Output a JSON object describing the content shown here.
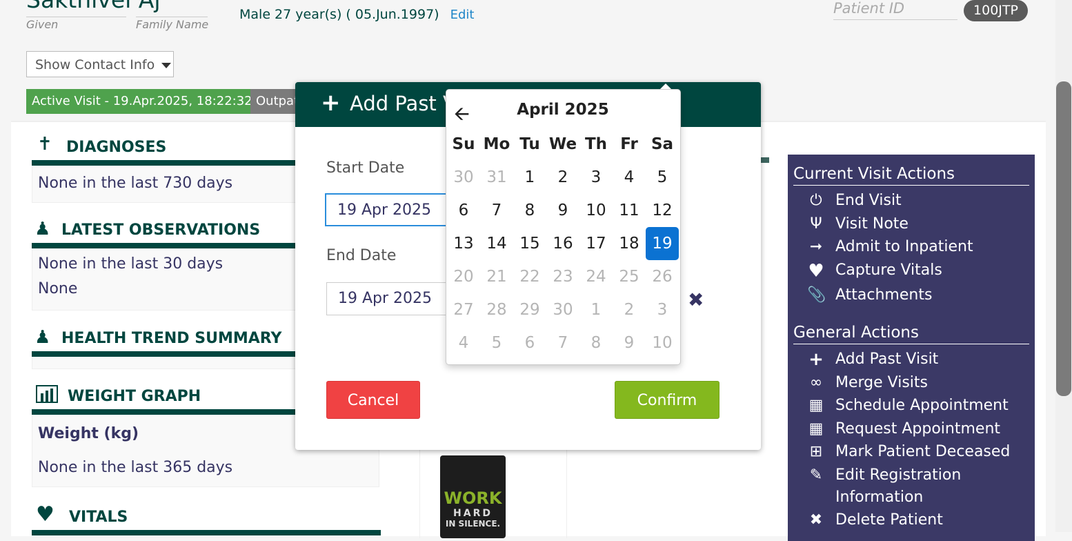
{
  "patient": {
    "name": "Sakthivel Aj",
    "given_caption": "Given",
    "family_caption": "Family Name",
    "demographics": "Male  27 year(s) ( 05.Jun.1997)",
    "edit_label": "Edit",
    "patient_id_placeholder": "Patient ID",
    "patient_id": "100JTP"
  },
  "contact_button": "Show Contact Info",
  "visit": {
    "active_badge": "Active Visit - 19.Apr.2025, 18:22:32",
    "type_badge": "Outpatient"
  },
  "sections": {
    "diagnoses": {
      "title": "DIAGNOSES",
      "lines": [
        "None in the last 730 days"
      ]
    },
    "observations": {
      "title": "LATEST OBSERVATIONS",
      "lines": [
        "None in the last 30 days",
        "None"
      ]
    },
    "health_trend": {
      "title": "HEALTH TREND SUMMARY"
    },
    "weight": {
      "title": "WEIGHT GRAPH",
      "subtitle": "Weight (kg)",
      "lines": [
        "None in the last 365 days"
      ]
    },
    "vitals": {
      "title": "VITALS"
    }
  },
  "right_panel": {
    "current_title": "Current Visit Actions",
    "current_items": [
      {
        "label": "End Visit",
        "icon": "power-icon"
      },
      {
        "label": "Visit Note",
        "icon": "stethoscope-icon"
      },
      {
        "label": "Admit to Inpatient",
        "icon": "sign-in-icon"
      },
      {
        "label": "Capture Vitals",
        "icon": "heartbeat-icon"
      },
      {
        "label": "Attachments",
        "icon": "paperclip-icon"
      }
    ],
    "general_title": "General Actions",
    "general_items": [
      {
        "label": "Add Past Visit",
        "icon": "plus-icon"
      },
      {
        "label": "Merge Visits",
        "icon": "link-icon"
      },
      {
        "label": "Schedule Appointment",
        "icon": "calendar-icon"
      },
      {
        "label": "Request Appointment",
        "icon": "calendar-icon"
      },
      {
        "label": "Mark Patient Deceased",
        "icon": "plus-square-icon"
      },
      {
        "label": "Edit Registration",
        "label2": "Information",
        "icon": "pencil-icon"
      },
      {
        "label": "Delete Patient",
        "icon": "times-icon"
      }
    ]
  },
  "thumbnail_text": [
    "WORK",
    "HARD",
    "IN SILENCE."
  ],
  "modal": {
    "title": "Add Past Visit",
    "start_label": "Start Date",
    "start_value": "19 Apr 2025",
    "end_label": "End Date",
    "end_value": "19 Apr 2025",
    "cancel": "Cancel",
    "confirm": "Confirm"
  },
  "datepicker": {
    "month_title": "April 2025",
    "weekdays": [
      "Su",
      "Mo",
      "Tu",
      "We",
      "Th",
      "Fr",
      "Sa"
    ],
    "weeks": [
      [
        {
          "d": "30",
          "m": true
        },
        {
          "d": "31",
          "m": true
        },
        {
          "d": "1"
        },
        {
          "d": "2"
        },
        {
          "d": "3"
        },
        {
          "d": "4"
        },
        {
          "d": "5"
        }
      ],
      [
        {
          "d": "6"
        },
        {
          "d": "7"
        },
        {
          "d": "8"
        },
        {
          "d": "9"
        },
        {
          "d": "10"
        },
        {
          "d": "11"
        },
        {
          "d": "12"
        }
      ],
      [
        {
          "d": "13"
        },
        {
          "d": "14"
        },
        {
          "d": "15"
        },
        {
          "d": "16"
        },
        {
          "d": "17"
        },
        {
          "d": "18"
        },
        {
          "d": "19",
          "sel": true
        }
      ],
      [
        {
          "d": "20",
          "m": true
        },
        {
          "d": "21",
          "m": true
        },
        {
          "d": "22",
          "m": true
        },
        {
          "d": "23",
          "m": true
        },
        {
          "d": "24",
          "m": true
        },
        {
          "d": "25",
          "m": true
        },
        {
          "d": "26",
          "m": true
        }
      ],
      [
        {
          "d": "27",
          "m": true
        },
        {
          "d": "28",
          "m": true
        },
        {
          "d": "29",
          "m": true
        },
        {
          "d": "30",
          "m": true
        },
        {
          "d": "1",
          "m": true
        },
        {
          "d": "2",
          "m": true
        },
        {
          "d": "3",
          "m": true
        }
      ],
      [
        {
          "d": "4",
          "m": true
        },
        {
          "d": "5",
          "m": true
        },
        {
          "d": "6",
          "m": true
        },
        {
          "d": "7",
          "m": true
        },
        {
          "d": "8",
          "m": true
        },
        {
          "d": "9",
          "m": true
        },
        {
          "d": "10",
          "m": true
        }
      ]
    ]
  }
}
